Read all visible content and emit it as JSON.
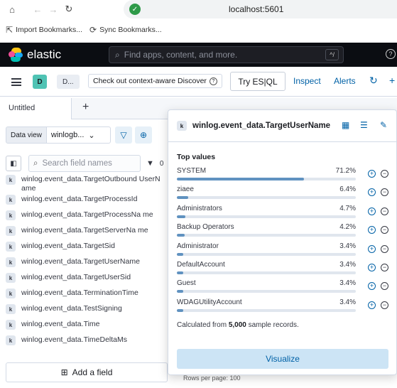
{
  "browser": {
    "url": "localhost:5601",
    "bookmarks": [
      {
        "label": "Import Bookmarks..."
      },
      {
        "label": "Sync Bookmarks..."
      }
    ]
  },
  "kibana": {
    "brand": "elastic",
    "search_placeholder": "Find apps, content, and more.",
    "shortcut": "^/",
    "help": "?"
  },
  "toolbar": {
    "space_initial": "D",
    "crumb": "D...",
    "banner": "Check out context-aware Discover",
    "try_esql": "Try ES|QL",
    "inspect": "Inspect",
    "alerts": "Alerts"
  },
  "tabs": {
    "active": "Untitled",
    "add": "+"
  },
  "sidebar": {
    "data_view_label": "Data view",
    "data_view_value": "winlogb...",
    "search_placeholder": "Search field names",
    "filter_count": "0",
    "add_field": "Add a field",
    "fields": [
      {
        "type": "k",
        "name": "winlog.event_data.TargetOutbound UserName"
      },
      {
        "type": "k",
        "name": "winlog.event_data.TargetProcessId"
      },
      {
        "type": "k",
        "name": "winlog.event_data.TargetProcessNa me"
      },
      {
        "type": "k",
        "name": "winlog.event_data.TargetServerNa me"
      },
      {
        "type": "k",
        "name": "winlog.event_data.TargetSid"
      },
      {
        "type": "k",
        "name": "winlog.event_data.TargetUserName"
      },
      {
        "type": "k",
        "name": "winlog.event_data.TargetUserSid"
      },
      {
        "type": "k",
        "name": "winlog.event_data.TerminationTime"
      },
      {
        "type": "k",
        "name": "winlog.event_data.TestSigning"
      },
      {
        "type": "k",
        "name": "winlog.event_data.Time"
      },
      {
        "type": "k",
        "name": "winlog.event_data.TimeDeltaMs"
      }
    ]
  },
  "popover": {
    "type": "k",
    "field_name": "winlog.event_data.TargetUserName",
    "top_values_title": "Top values",
    "top_values": [
      {
        "label": "SYSTEM",
        "pct_label": "71.2%",
        "pct": 71.2
      },
      {
        "label": "ziaee",
        "pct_label": "6.4%",
        "pct": 6.4
      },
      {
        "label": "Administrators",
        "pct_label": "4.7%",
        "pct": 4.7
      },
      {
        "label": "Backup Operators",
        "pct_label": "4.2%",
        "pct": 4.2
      },
      {
        "label": "Administrator",
        "pct_label": "3.4%",
        "pct": 3.4
      },
      {
        "label": "DefaultAccount",
        "pct_label": "3.4%",
        "pct": 3.4
      },
      {
        "label": "Guest",
        "pct_label": "3.4%",
        "pct": 3.4
      },
      {
        "label": "WDAGUtilityAccount",
        "pct_label": "3.4%",
        "pct": 3.4
      }
    ],
    "calc_prefix": "Calculated from",
    "calc_count": "5,000",
    "calc_suffix": "sample records.",
    "visualize": "Visualize"
  },
  "footer": {
    "rows_per_page": "Rows per page: 100"
  },
  "colors": {
    "accent": "#0061a6",
    "bar": "#6092c0",
    "header_bg": "#0b0d12"
  }
}
